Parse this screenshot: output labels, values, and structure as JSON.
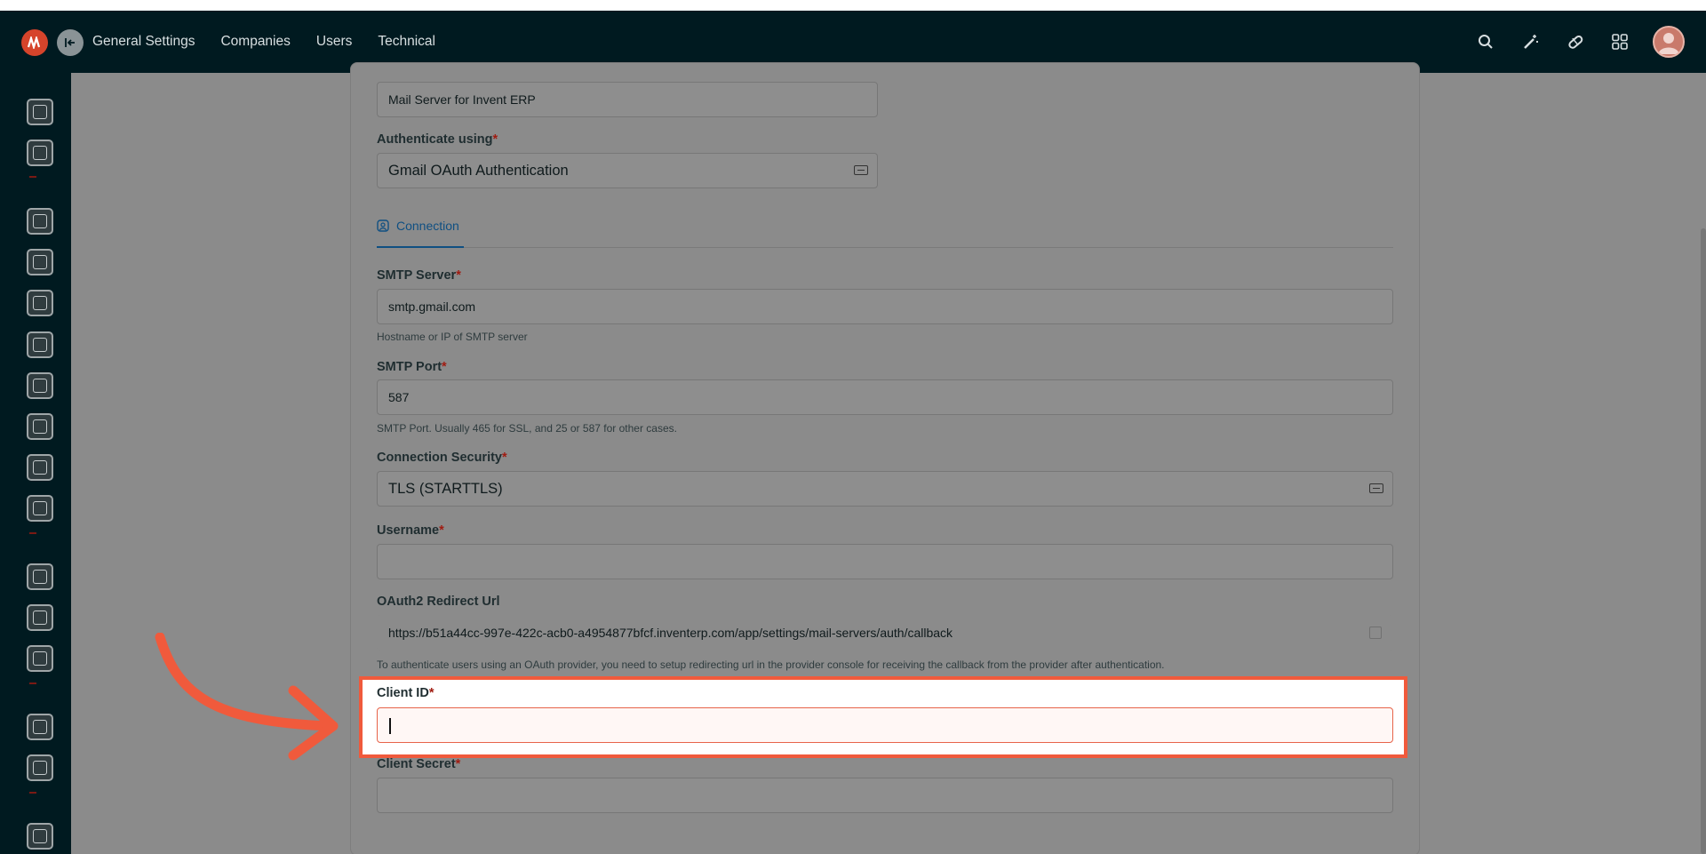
{
  "topbar": {
    "nav": [
      "General Settings",
      "Companies",
      "Users",
      "Technical"
    ],
    "icons": [
      "search-icon",
      "magic-wand-icon",
      "pill-icon",
      "grid-icon"
    ],
    "avatar": "user-avatar"
  },
  "sidebar": {
    "icons": [
      "dashboard-icon",
      "analytics-icon",
      "inventory-icon",
      "reports-icon",
      "clock-icon",
      "clipboard-icon",
      "box-icon",
      "tag-icon",
      "search-user-icon",
      "calendar-icon",
      "headset-icon",
      "folder-icon",
      "device-icon",
      "settings-icon",
      "document-icon",
      "logout-icon"
    ]
  },
  "form": {
    "name_value": "Mail Server for Invent ERP",
    "auth_label": "Authenticate using",
    "auth_value": "Gmail OAuth Authentication",
    "tab_label": "Connection",
    "smtp_server_label": "SMTP Server",
    "smtp_server_value": "smtp.gmail.com",
    "smtp_server_hint": "Hostname or IP of SMTP server",
    "smtp_port_label": "SMTP Port",
    "smtp_port_value": "587",
    "smtp_port_hint": "SMTP Port. Usually 465 for SSL, and 25 or 587 for other cases.",
    "security_label": "Connection Security",
    "security_value": "TLS (STARTTLS)",
    "username_label": "Username",
    "redirect_label": "OAuth2 Redirect Url",
    "redirect_value": "https://b51a44cc-997e-422c-acb0-a4954877bfcf.inventerp.com/app/settings/mail-servers/auth/callback",
    "redirect_hint": "To authenticate users using an OAuth provider, you need to setup redirecting url in the provider console for receiving the callback from the provider after authentication.",
    "client_id_label": "Client ID",
    "client_secret_label": "Client Secret",
    "required_mark": "*"
  },
  "colors": {
    "highlight": "#f05a3c",
    "accent": "#0f4f82",
    "topbar": "#001a20"
  }
}
